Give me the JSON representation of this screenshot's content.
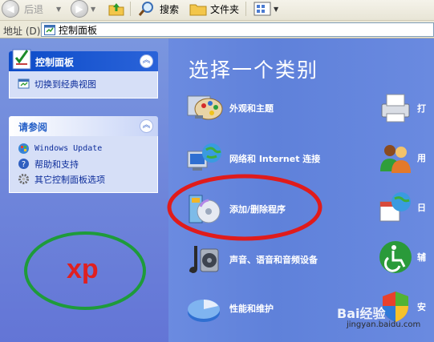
{
  "toolbar": {
    "back_label": "后退",
    "search_label": "搜索",
    "folders_label": "文件夹"
  },
  "address": {
    "label": "地址 (D)",
    "value": "控制面板"
  },
  "sidebar": {
    "control_panel": {
      "title": "控制面板",
      "links": [
        {
          "label": "切换到经典视图",
          "icon": "switch-view-icon"
        }
      ]
    },
    "see_also": {
      "title": "请参阅",
      "links": [
        {
          "label": "Windows Update",
          "icon": "windows-update-icon"
        },
        {
          "label": "帮助和支持",
          "icon": "help-icon"
        },
        {
          "label": "其它控制面板选项",
          "icon": "gear-icon"
        }
      ]
    }
  },
  "main": {
    "title": "选择一个类别",
    "categories": [
      {
        "label": "外观和主题",
        "icon": "appearance-palette-icon"
      },
      {
        "label": "网络和 Internet 连接",
        "icon": "network-globe-icon"
      },
      {
        "label": "添加/删除程序",
        "icon": "add-remove-programs-icon"
      },
      {
        "label": "声音、语音和音频设备",
        "icon": "sound-speaker-icon"
      },
      {
        "label": "性能和维护",
        "icon": "performance-chart-icon"
      }
    ],
    "right_categories": [
      {
        "label": "打",
        "icon": "printer-icon"
      },
      {
        "label": "用",
        "icon": "user-accounts-icon"
      },
      {
        "label": "日",
        "icon": "date-globe-icon"
      },
      {
        "label": "辅",
        "icon": "accessibility-icon"
      },
      {
        "label": "安",
        "icon": "security-shield-icon"
      }
    ]
  },
  "annotations": {
    "xp_text": "xp",
    "highlight_color": "#e01b1b",
    "circle_color": "#1e9b3a"
  },
  "watermark": {
    "text": "Bai经验",
    "url": "jingyan.baidu.com"
  },
  "colors": {
    "accent": "#0c4bc8",
    "background": "#5d7fd6"
  }
}
